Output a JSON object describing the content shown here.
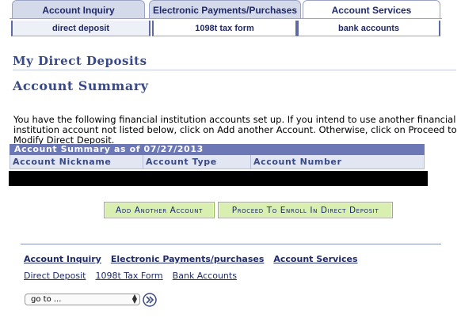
{
  "top_tabs": [
    {
      "label": "Account Inquiry",
      "active": false
    },
    {
      "label": "Electronic Payments/Purchases",
      "active": false
    },
    {
      "label": "Account Services",
      "active": true
    }
  ],
  "sub_tabs": [
    {
      "label": "direct deposit",
      "active": true
    },
    {
      "label": "1098t tax form",
      "active": false
    },
    {
      "label": "bank accounts",
      "active": false
    }
  ],
  "page": {
    "section_title": "My Direct Deposits",
    "subtitle": "Account Summary",
    "intro": "You have the following financial institution accounts set up.  If you intend to use another financial institution account not listed below, click on Add another Account.  Otherwise, click on Proceed to Modify Direct Deposit."
  },
  "table": {
    "caption": "Account Summary as of 07/27/2013",
    "columns": [
      "Account Nickname",
      "Account Type",
      "Account Number"
    ]
  },
  "buttons": {
    "add_account": "Add Another Account",
    "proceed": "Proceed To Enroll In Direct Deposit"
  },
  "footer": {
    "primary_links": [
      "Account Inquiry",
      "Electronic Payments/purchases",
      "Account Services"
    ],
    "secondary_links": [
      "Direct Deposit",
      "1098t Tax Form",
      "Bank Accounts"
    ],
    "goto_value": "go to ...",
    "go_icon": "double-chevron-right-icon"
  },
  "colors": {
    "brand_navy": "#202a6a",
    "table_header": "#6c78b6",
    "button_green": "#d9efb0"
  }
}
